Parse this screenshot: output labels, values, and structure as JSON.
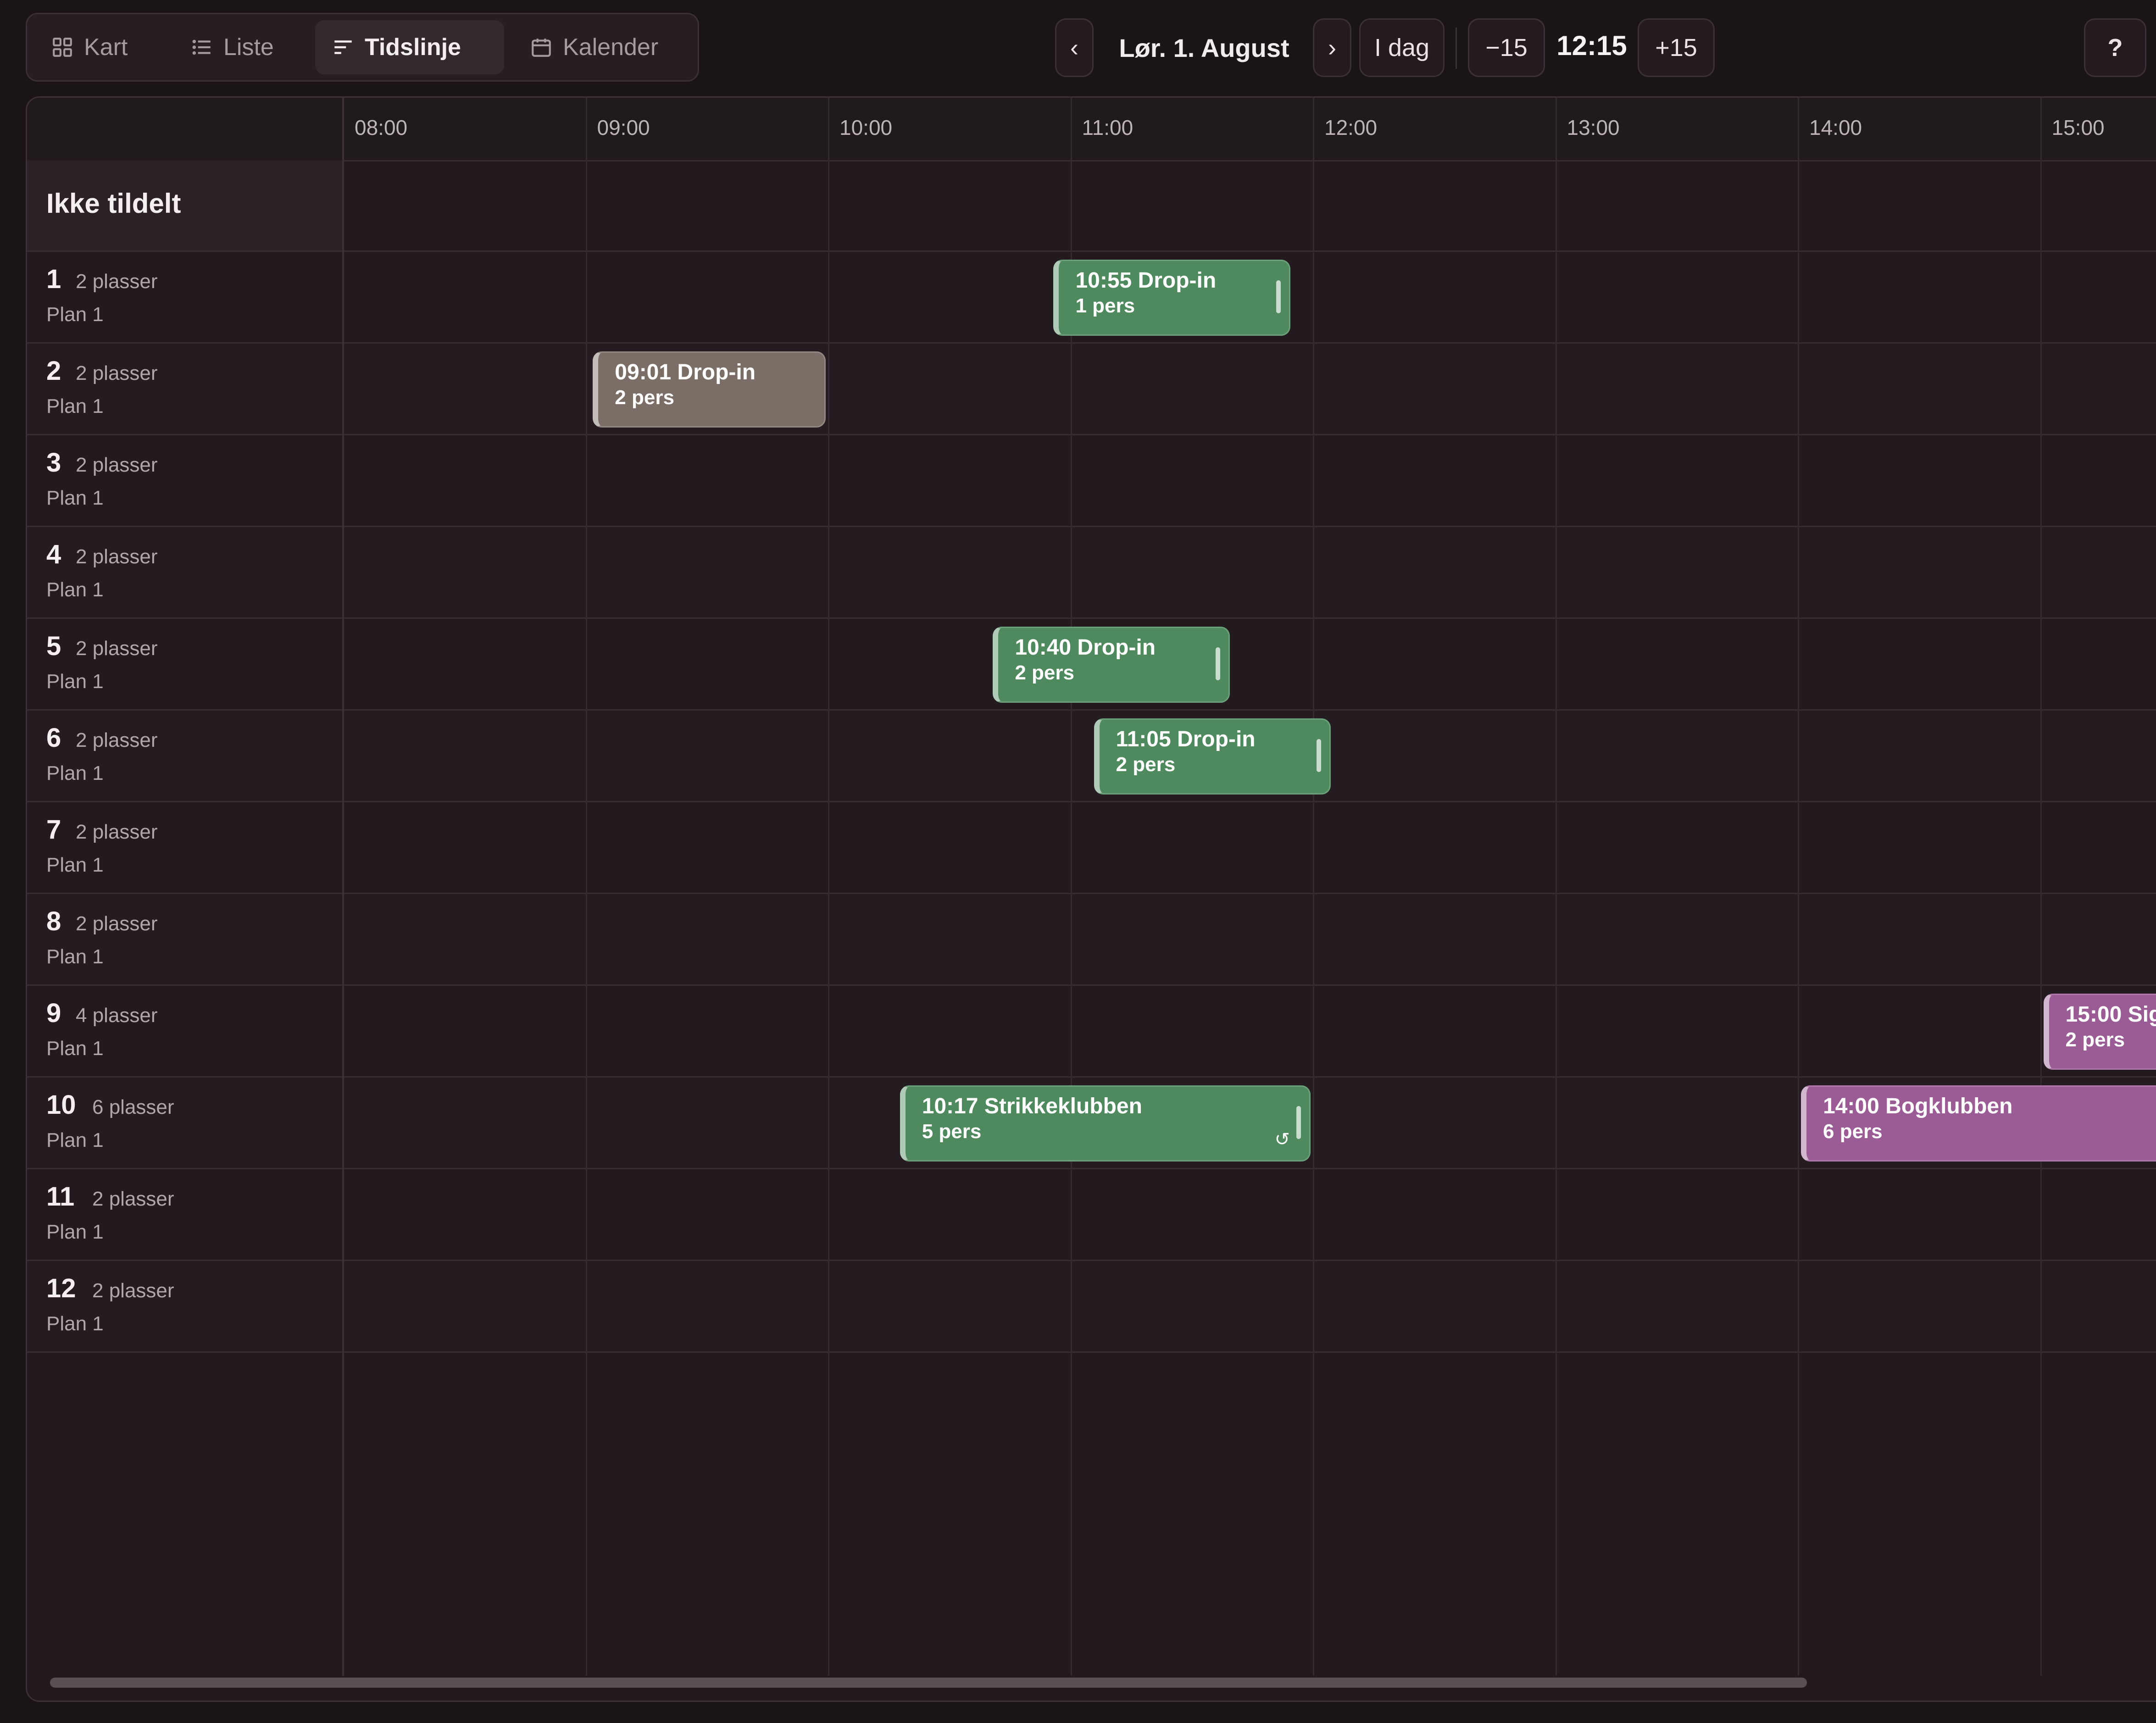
{
  "view_tabs": [
    {
      "label": "Kart",
      "icon": "grid-icon"
    },
    {
      "label": "Liste",
      "icon": "list-icon"
    },
    {
      "label": "Tidslinje",
      "icon": "timeline-icon",
      "active": true
    },
    {
      "label": "Kalender",
      "icon": "calendar-icon"
    }
  ],
  "date_nav": {
    "prev": "‹",
    "date": "Lør. 1. August",
    "next": "›",
    "today": "I dag",
    "minus": "−15",
    "time": "12:15",
    "plus": "+15"
  },
  "help": "?",
  "timeline": {
    "hours": [
      "08:00",
      "09:00",
      "10:00",
      "11:00",
      "12:00",
      "13:00",
      "14:00",
      "15:00"
    ],
    "unassigned_label": "Ikke tildelt",
    "tables": [
      {
        "num": "1",
        "capacity": "2 plasser",
        "plan": "Plan 1"
      },
      {
        "num": "2",
        "capacity": "2 plasser",
        "plan": "Plan 1"
      },
      {
        "num": "3",
        "capacity": "2 plasser",
        "plan": "Plan 1"
      },
      {
        "num": "4",
        "capacity": "2 plasser",
        "plan": "Plan 1"
      },
      {
        "num": "5",
        "capacity": "2 plasser",
        "plan": "Plan 1"
      },
      {
        "num": "6",
        "capacity": "2 plasser",
        "plan": "Plan 1"
      },
      {
        "num": "7",
        "capacity": "2 plasser",
        "plan": "Plan 1"
      },
      {
        "num": "8",
        "capacity": "2 plasser",
        "plan": "Plan 1"
      },
      {
        "num": "9",
        "capacity": "4 plasser",
        "plan": "Plan 1"
      },
      {
        "num": "10",
        "capacity": "6 plasser",
        "plan": "Plan 1"
      },
      {
        "num": "11",
        "capacity": "2 plasser",
        "plan": "Plan 1"
      },
      {
        "num": "12",
        "capacity": "2 plasser",
        "plan": "Plan 1"
      }
    ],
    "bookings": [
      {
        "table": "1",
        "start": "10:55",
        "end": "11:55",
        "title": "10:55  Drop-in",
        "guests": "1 pers",
        "color": "#4e8a5e",
        "kind": "green"
      },
      {
        "table": "2",
        "start": "09:01",
        "end": "10:00",
        "title": "09:01  Drop-in",
        "guests": "2 pers",
        "color": "#7a6e67",
        "kind": "grey"
      },
      {
        "table": "5",
        "start": "10:40",
        "end": "11:40",
        "title": "10:40  Drop-in",
        "guests": "2 pers",
        "color": "#4e8a5e",
        "kind": "green"
      },
      {
        "table": "6",
        "start": "11:05",
        "end": "12:05",
        "title": "11:05  Drop-in",
        "guests": "2 pers",
        "color": "#4e8a5e",
        "kind": "green"
      },
      {
        "table": "9",
        "start": "15:00",
        "end": "16:00",
        "title": "15:00  Sig",
        "guests": "2 pers",
        "color": "#9b5c95",
        "kind": "pink"
      },
      {
        "table": "10",
        "start": "10:17",
        "end": "12:00",
        "title": "10:17  Strikkeklubben",
        "guests": "5 pers",
        "color": "#4e8a5e",
        "kind": "green",
        "recurring": true
      },
      {
        "table": "10",
        "start": "14:00",
        "end": "16:00",
        "title": "14:00  Bogklubben",
        "guests": "6 pers",
        "color": "#9b5c95",
        "kind": "pink"
      }
    ]
  },
  "colors": {
    "background": "#1a1416",
    "drop_in": "#4e8a5e",
    "completed": "#7a6e67",
    "event": "#9b5c95"
  }
}
